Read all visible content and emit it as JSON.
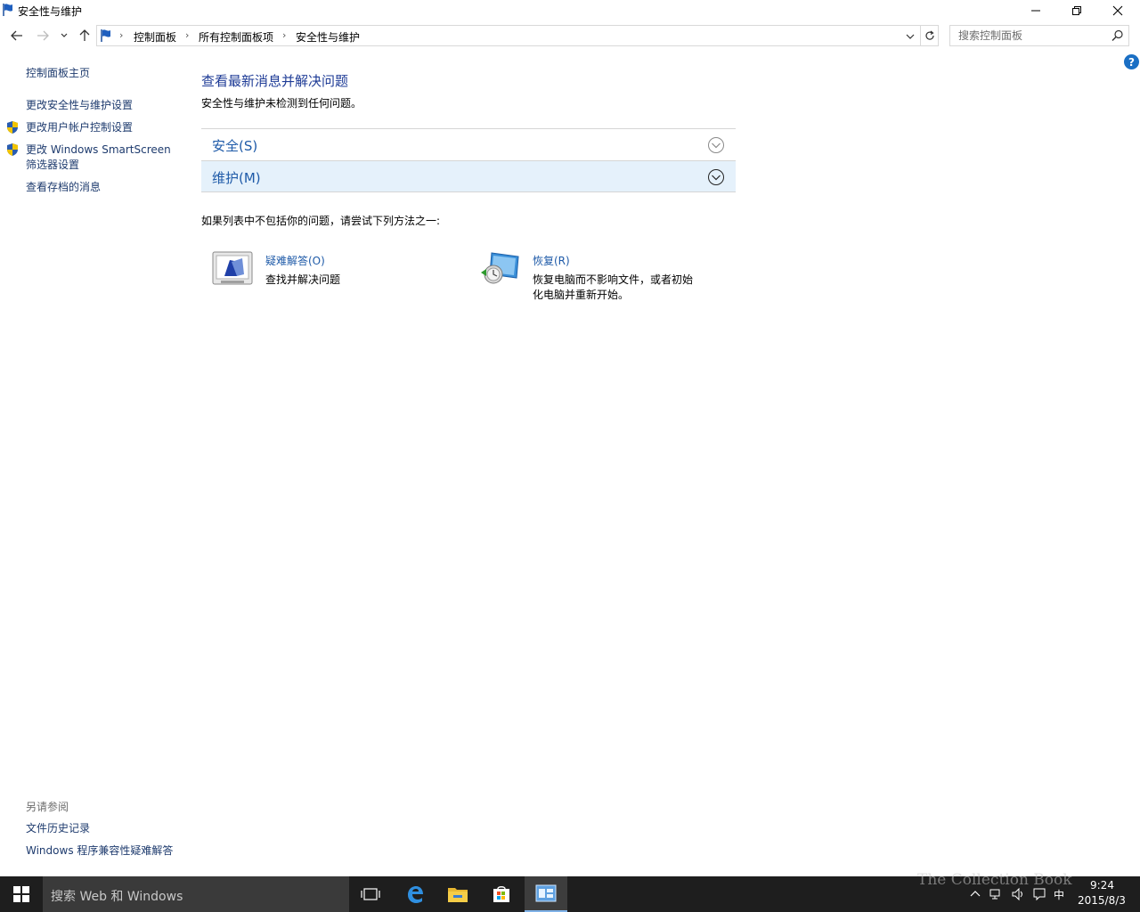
{
  "window": {
    "title": "安全性与维护",
    "minimize": "minimize",
    "maximize": "restore",
    "close": "close"
  },
  "address": {
    "crumbs": [
      "控制面板",
      "所有控制面板项",
      "安全性与维护"
    ],
    "search_placeholder": "搜索控制面板"
  },
  "sidebar": {
    "items": [
      {
        "label": "控制面板主页"
      },
      {
        "label": "更改安全性与维护设置"
      },
      {
        "label": "更改用户帐户控制设置"
      },
      {
        "label": "更改 Windows SmartScreen"
      },
      {
        "label": "筛选器设置"
      },
      {
        "label": "查看存档的消息"
      }
    ],
    "see_also": "另请参阅",
    "see_also_items": [
      {
        "label": "文件历史记录"
      },
      {
        "label": "Windows 程序兼容性疑难解答"
      }
    ]
  },
  "main": {
    "title": "查看最新消息并解决问题",
    "subtitle": "安全性与维护未检测到任何问题。",
    "sections": [
      {
        "label": "安全(S)"
      },
      {
        "label": "维护(M)"
      }
    ],
    "hint": "如果列表中不包括你的问题，请尝试下列方法之一:",
    "tools": [
      {
        "title": "疑难解答(O)",
        "desc": [
          "查找并解决问题"
        ]
      },
      {
        "title": "恢复(R)",
        "desc": [
          "恢复电脑而不影响文件，或者初始",
          "化电脑并重新开始。"
        ]
      }
    ]
  },
  "taskbar": {
    "search_text": "搜索 Web 和 Windows",
    "ime": "中",
    "time": "9:24",
    "date": "2015/8/3",
    "watermark": "The Collection Book"
  },
  "colors": {
    "link": "#1e3b6e",
    "heading": "#1e3b96",
    "section_text": "#1e5aa8",
    "section_selected_bg": "#e5f1fb",
    "taskbar_bg": "#1e1e1e"
  }
}
